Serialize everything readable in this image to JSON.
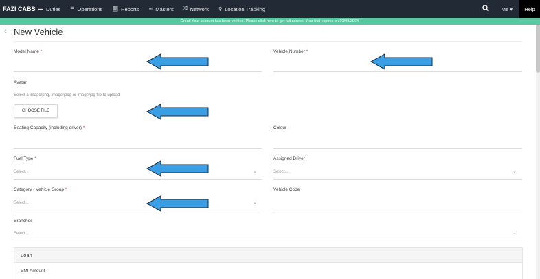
{
  "nav": {
    "brand": "FAZI CABS",
    "items": [
      {
        "label": "Duties",
        "icon": "minus-icon"
      },
      {
        "label": "Operations",
        "icon": "menu-icon"
      },
      {
        "label": "Reports",
        "icon": "chart-icon"
      },
      {
        "label": "Masters",
        "icon": "layers-icon"
      },
      {
        "label": "Network",
        "icon": "shuffle-icon"
      },
      {
        "label": "Location Tracking",
        "icon": "map-pin-icon"
      }
    ],
    "me": "Me ▾",
    "help": "Help"
  },
  "banner": {
    "text": "Great! Your account has been verified. Please click here to get full access. Your trial expires on 01/08/2024."
  },
  "page": {
    "title": "New Vehicle",
    "back_icon": "‹"
  },
  "form": {
    "model_name": {
      "label": "Model Name",
      "required": "*"
    },
    "vehicle_number": {
      "label": "Vehicle Number",
      "required": "*"
    },
    "avatar": {
      "label": "Avatar",
      "helper": "Select a image/png, image/jpeg or image/jpg file to upload",
      "button": "CHOOSE FILE"
    },
    "seating_capacity": {
      "label": "Seating Capacity (including driver)",
      "required": "*"
    },
    "colour": {
      "label": "Colour"
    },
    "fuel_type": {
      "label": "Fuel Type",
      "required": "*",
      "placeholder": "Select..."
    },
    "assigned_driver": {
      "label": "Assigned Driver",
      "placeholder": "Select..."
    },
    "category": {
      "label": "Category - Vehicle Group",
      "required": "*",
      "placeholder": "Select..."
    },
    "vehicle_code": {
      "label": "Vehicle Code"
    },
    "branches": {
      "label": "Branches",
      "placeholder": "Select..."
    }
  },
  "loan": {
    "title": "Loan",
    "emi_label": "EMI Amount"
  },
  "colors": {
    "navbar": "#222b35",
    "banner": "#57c8a0",
    "arrow_fill": "#3a9ee4",
    "arrow_stroke": "#1c2a3a"
  }
}
